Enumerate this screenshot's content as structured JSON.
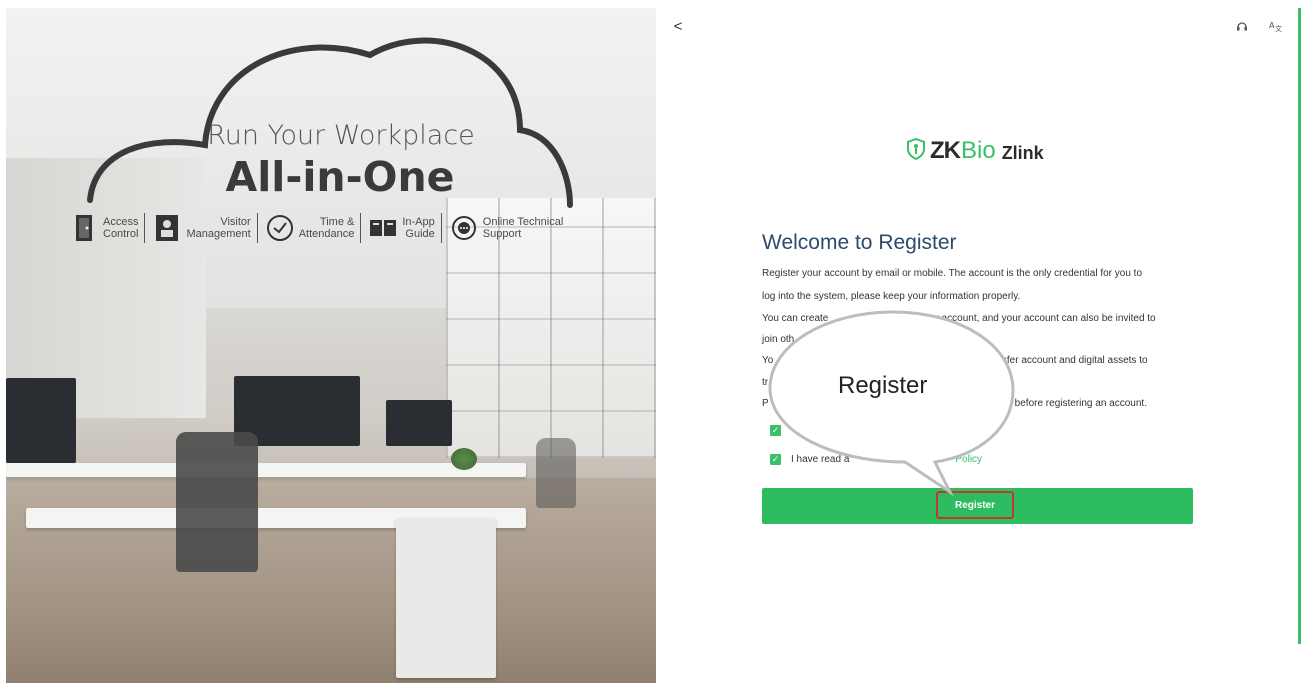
{
  "hero": {
    "slogan_line1": "Run Your Workplace",
    "slogan_line2": "All-in-One",
    "features": [
      {
        "icon": "door-icon",
        "label": "Access\nControl"
      },
      {
        "icon": "visitor-icon",
        "label": "Visitor\nManagement"
      },
      {
        "icon": "clock-icon",
        "label": "Time &\nAttendance"
      },
      {
        "icon": "book-icon",
        "label": "In-App\nGuide"
      },
      {
        "icon": "chat-support-icon",
        "label": "Online Technical\nSupport"
      }
    ]
  },
  "header": {
    "back_label": "<",
    "support_icon": "headset-icon",
    "language_icon": "translate-icon"
  },
  "logo": {
    "zk": "ZK",
    "bio": "Bio",
    "product": "Zlink"
  },
  "register": {
    "title": "Welcome to Register",
    "para1_line1": "Register your account by email or mobile. The account is the only credential for you to",
    "para1_line2": "log into the system, please keep your information properly.",
    "para2_line1a": "You can create",
    "para2_line1b": "our account, and your account can also be invited to",
    "para2_line2": "join oth",
    "para3_line1a": "Yo",
    "para3_line1b": "nsfer account and digital assets to",
    "para3_line2": "tr",
    "para4_a": "P",
    "para4_b": "before registering an account.",
    "check2_text_a": "I have read a",
    "check2_link": "Policy",
    "button_label": "Register"
  },
  "callout": {
    "text": "Register"
  },
  "colors": {
    "accent": "#2dbd60",
    "title": "#2e4a6b",
    "highlight": "#c0392b"
  }
}
